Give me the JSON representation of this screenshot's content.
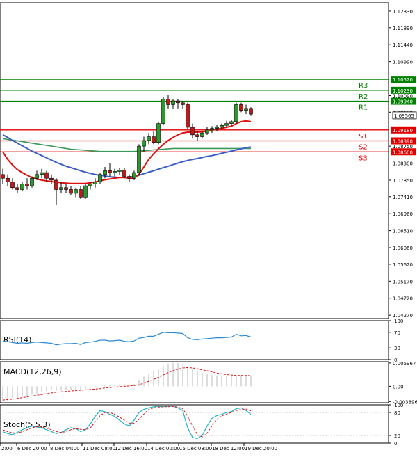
{
  "chart_data": {
    "type": "candlestick",
    "price_panel": {
      "ylim": [
        1.0418,
        1.1255
      ],
      "yticks": [
        "1.12330",
        "1.11890",
        "1.11440",
        "1.10990",
        "1.10090",
        "1.09650",
        "1.08750",
        "1.08300",
        "1.07850",
        "1.07410",
        "1.06960",
        "1.06510",
        "1.06060",
        "1.05620",
        "1.05170",
        "1.04720",
        "1.04270"
      ],
      "current_price": "1.09565",
      "levels": [
        {
          "label": "R3",
          "value": "1.10520",
          "color": "#008000"
        },
        {
          "label": "R2",
          "value": "1.10230",
          "color": "#008000"
        },
        {
          "label": "R1",
          "value": "1.09940",
          "color": "#008000"
        },
        {
          "label": "S1",
          "value": "1.09180",
          "color": "#e00000"
        },
        {
          "label": "S2",
          "value": "1.08890",
          "color": "#e00000"
        },
        {
          "label": "S3",
          "value": "1.08600",
          "color": "#e00000"
        }
      ],
      "candles": [
        [
          1.08,
          1.0815,
          1.0775,
          1.079
        ],
        [
          1.079,
          1.08,
          1.077,
          1.078
        ],
        [
          1.078,
          1.079,
          1.076,
          1.0765
        ],
        [
          1.0765,
          1.0775,
          1.075,
          1.076
        ],
        [
          1.076,
          1.078,
          1.0755,
          1.0775
        ],
        [
          1.0775,
          1.079,
          1.076,
          1.077
        ],
        [
          1.077,
          1.0795,
          1.0765,
          1.079
        ],
        [
          1.079,
          1.081,
          1.0785,
          1.08
        ],
        [
          1.08,
          1.0815,
          1.079,
          1.0805
        ],
        [
          1.0805,
          1.081,
          1.078,
          1.079
        ],
        [
          1.079,
          1.08,
          1.0775,
          1.0785
        ],
        [
          1.0785,
          1.079,
          1.072,
          1.076
        ],
        [
          1.076,
          1.078,
          1.075,
          1.0765
        ],
        [
          1.0765,
          1.0775,
          1.075,
          1.076
        ],
        [
          1.076,
          1.077,
          1.0745,
          1.075
        ],
        [
          1.075,
          1.0765,
          1.074,
          1.076
        ],
        [
          1.076,
          1.077,
          1.0735,
          1.074
        ],
        [
          1.074,
          1.0775,
          1.0735,
          1.077
        ],
        [
          1.077,
          1.078,
          1.076,
          1.0775
        ],
        [
          1.0775,
          1.079,
          1.0765,
          1.078
        ],
        [
          1.078,
          1.0805,
          1.0775,
          1.08
        ],
        [
          1.08,
          1.082,
          1.079,
          1.081
        ],
        [
          1.081,
          1.083,
          1.0795,
          1.0805
        ],
        [
          1.0805,
          1.0815,
          1.0795,
          1.0808
        ],
        [
          1.0808,
          1.0818,
          1.0798,
          1.0812
        ],
        [
          1.0812,
          1.0818,
          1.079,
          1.0795
        ],
        [
          1.0795,
          1.08,
          1.078,
          1.079
        ],
        [
          1.079,
          1.081,
          1.0785,
          1.0805
        ],
        [
          1.0805,
          1.088,
          1.08,
          1.0875
        ],
        [
          1.0875,
          1.09,
          1.086,
          1.089
        ],
        [
          1.089,
          1.091,
          1.088,
          1.09
        ],
        [
          1.09,
          1.0915,
          1.088,
          1.0885
        ],
        [
          1.0885,
          1.094,
          1.088,
          1.0935
        ],
        [
          1.0935,
          1.1005,
          1.093,
          1.1
        ],
        [
          1.1,
          1.101,
          1.0975,
          1.0985
        ],
        [
          1.0985,
          1.1,
          1.0975,
          1.0995
        ],
        [
          1.0995,
          1.1,
          1.0975,
          1.099
        ],
        [
          1.099,
          1.0995,
          1.0975,
          1.0985
        ],
        [
          1.0985,
          1.099,
          1.092,
          1.0925
        ],
        [
          1.0925,
          1.0935,
          1.0895,
          1.0905
        ],
        [
          1.0905,
          1.0915,
          1.089,
          1.09
        ],
        [
          1.09,
          1.0915,
          1.0895,
          1.091
        ],
        [
          1.091,
          1.0925,
          1.0905,
          1.0918
        ],
        [
          1.0918,
          1.0928,
          1.091,
          1.0922
        ],
        [
          1.0922,
          1.0932,
          1.0915,
          1.0925
        ],
        [
          1.0925,
          1.0935,
          1.0918,
          1.093
        ],
        [
          1.093,
          1.0942,
          1.0925,
          1.0935
        ],
        [
          1.0935,
          1.0945,
          1.093,
          1.094
        ],
        [
          1.094,
          1.099,
          1.0935,
          1.0985
        ],
        [
          1.0985,
          1.099,
          1.0965,
          1.097
        ],
        [
          1.097,
          1.0985,
          1.096,
          1.0975
        ],
        [
          1.0975,
          1.0978,
          1.0955,
          1.096
        ]
      ],
      "ma_red": [
        1.086,
        1.084,
        1.0825,
        1.0813,
        1.0805,
        1.0798,
        1.0792,
        1.0788,
        1.0785,
        1.0783,
        1.0781,
        1.078,
        1.0778,
        1.0777,
        1.0776,
        1.0776,
        1.0776,
        1.0776,
        1.0778,
        1.078,
        1.0783,
        1.0786,
        1.0788,
        1.079,
        1.0792,
        1.0792,
        1.079,
        1.079,
        1.08,
        1.082,
        1.084,
        1.0855,
        1.0868,
        1.088,
        1.089,
        1.0898,
        1.0905,
        1.091,
        1.0912,
        1.0912,
        1.0912,
        1.0913,
        1.0915,
        1.0918,
        1.092,
        1.0922,
        1.0925,
        1.0928,
        1.0935,
        1.094,
        1.0942,
        1.094
      ],
      "ma_blue": [
        1.0905,
        1.0898,
        1.089,
        1.0883,
        1.0876,
        1.0869,
        1.0862,
        1.0856,
        1.085,
        1.0844,
        1.0838,
        1.0832,
        1.0827,
        1.0822,
        1.0818,
        1.0814,
        1.081,
        1.0806,
        1.0803,
        1.08,
        1.0798,
        1.0796,
        1.0794,
        1.0793,
        1.0792,
        1.0792,
        1.0793,
        1.0795,
        1.0798,
        1.0802,
        1.0806,
        1.081,
        1.0814,
        1.0818,
        1.0822,
        1.0826,
        1.083,
        1.0834,
        1.0837,
        1.084,
        1.0842,
        1.0845,
        1.0848,
        1.085,
        1.0853,
        1.0856,
        1.0859,
        1.0862,
        1.0865,
        1.0868,
        1.0871,
        1.0873
      ],
      "ma_green": [
        1.0895,
        1.0893,
        1.0891,
        1.0889,
        1.0887,
        1.0885,
        1.0883,
        1.0881,
        1.0879,
        1.0877,
        1.0875,
        1.0873,
        1.0871,
        1.0869,
        1.0867,
        1.0866,
        1.0865,
        1.0864,
        1.0863,
        1.0862,
        1.0861,
        1.0861,
        1.0861,
        1.0861,
        1.0861,
        1.0861,
        1.0861,
        1.0861,
        1.0862,
        1.0863,
        1.0864,
        1.0865,
        1.0866,
        1.0867,
        1.0868,
        1.0869,
        1.0869,
        1.0869,
        1.0869,
        1.0869,
        1.0869,
        1.0869,
        1.0869,
        1.0869,
        1.0869,
        1.0869,
        1.0869,
        1.0869,
        1.0869,
        1.0869,
        1.0869,
        1.0869
      ]
    },
    "rsi": {
      "label": "RSI(14)",
      "yticks": [
        "100",
        "70",
        "30",
        "0"
      ],
      "values": [
        48,
        46,
        44,
        42,
        43,
        42,
        44,
        45,
        44,
        43,
        42,
        38,
        40,
        41,
        41,
        42,
        39,
        44,
        45,
        47,
        50,
        50,
        48,
        49,
        50,
        47,
        46,
        48,
        55,
        57,
        60,
        60,
        65,
        70,
        69,
        69,
        68,
        67,
        56,
        52,
        51,
        53,
        54,
        55,
        56,
        56,
        57,
        58,
        65,
        61,
        62,
        58
      ]
    },
    "macd": {
      "label": "MACD(12,26,9)",
      "yticks": [
        "0.005967",
        "0.00",
        "-0.003896"
      ],
      "ylim": [
        -0.0042,
        0.0063
      ],
      "histogram": [
        -0.0039,
        -0.0036,
        -0.0033,
        -0.003,
        -0.0027,
        -0.0024,
        -0.0021,
        -0.0018,
        -0.0015,
        -0.0012,
        -0.001,
        -0.0011,
        -0.0011,
        -0.001,
        -0.0009,
        -0.0008,
        -0.0008,
        -0.0006,
        -0.0004,
        -0.0002,
        0.0,
        0.0002,
        0.0003,
        0.0004,
        0.0005,
        0.0005,
        0.0005,
        0.0006,
        0.0015,
        0.0025,
        0.0032,
        0.0038,
        0.0045,
        0.0052,
        0.0058,
        0.006,
        0.0059,
        0.0057,
        0.005,
        0.0043,
        0.0038,
        0.0034,
        0.0031,
        0.0029,
        0.0028,
        0.0027,
        0.0026,
        0.0026,
        0.0028,
        0.0028,
        0.0028,
        0.0027
      ],
      "signal": [
        -0.0035,
        -0.0034,
        -0.0033,
        -0.0031,
        -0.0029,
        -0.0027,
        -0.0025,
        -0.0023,
        -0.0021,
        -0.0019,
        -0.0017,
        -0.0015,
        -0.0014,
        -0.0013,
        -0.0012,
        -0.0011,
        -0.001,
        -0.0009,
        -0.0008,
        -0.0007,
        -0.0006,
        -0.0004,
        -0.0003,
        -0.0002,
        -0.0001,
        0.0,
        0.0001,
        0.0002,
        0.0004,
        0.0008,
        0.0013,
        0.0018,
        0.0023,
        0.0029,
        0.0035,
        0.004,
        0.0044,
        0.0047,
        0.0048,
        0.0047,
        0.0045,
        0.0042,
        0.004,
        0.0037,
        0.0034,
        0.0032,
        0.003,
        0.0029,
        0.0028,
        0.0028,
        0.0028,
        0.0027
      ]
    },
    "stoch": {
      "label": "Stoch(5,5,3)",
      "yticks": [
        "100",
        "80",
        "20",
        "0"
      ],
      "main": [
        30,
        25,
        22,
        28,
        35,
        40,
        45,
        42,
        40,
        35,
        30,
        25,
        28,
        35,
        40,
        38,
        30,
        35,
        50,
        70,
        85,
        82,
        75,
        70,
        60,
        50,
        45,
        60,
        80,
        88,
        92,
        95,
        96,
        95,
        96,
        96,
        92,
        85,
        40,
        15,
        12,
        20,
        45,
        65,
        72,
        75,
        80,
        82,
        90,
        92,
        85,
        75
      ],
      "signal": [
        35,
        30,
        27,
        26,
        30,
        35,
        40,
        43,
        42,
        39,
        35,
        30,
        28,
        30,
        35,
        38,
        36,
        35,
        40,
        55,
        72,
        80,
        80,
        75,
        68,
        60,
        52,
        52,
        62,
        76,
        88,
        92,
        94,
        95,
        95,
        96,
        94,
        90,
        70,
        45,
        22,
        16,
        26,
        45,
        62,
        71,
        76,
        80,
        85,
        88,
        89,
        84
      ]
    },
    "x_labels": [
      "2:00",
      "6 Dec 20:00",
      "8 Dec 04:00",
      "11 Dec 08:00",
      "12 Dec 16:00",
      "14 Dec 00:00",
      "15 Dec 08:00",
      "18 Dec 12:00",
      "19 Dec 20:00"
    ]
  }
}
